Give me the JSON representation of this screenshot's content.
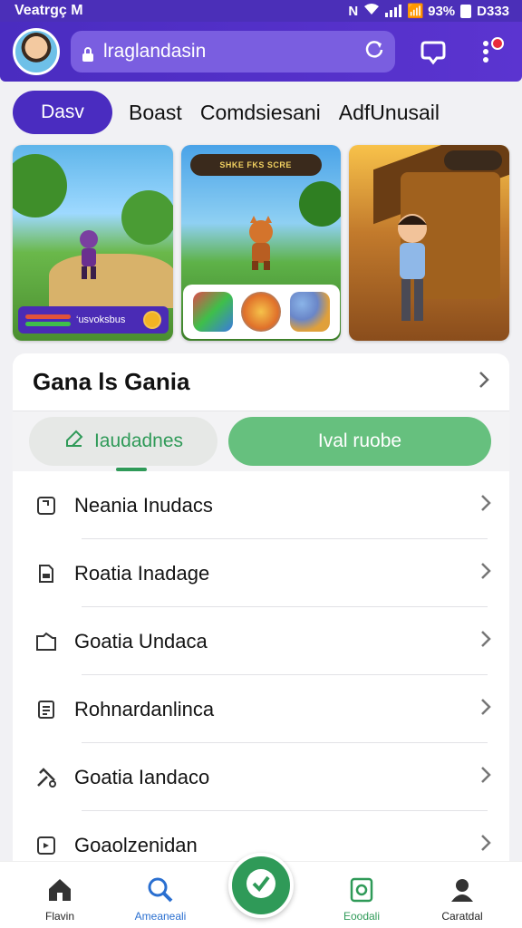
{
  "status_bar": {
    "carrier": "Veatrgç M",
    "battery_text": "📶 93%",
    "time": "D333",
    "network_label": "N"
  },
  "header": {
    "search_value": "lraglandasin",
    "icons": [
      "avatar",
      "lock-icon",
      "reload-icon",
      "chat-icon",
      "more-icon"
    ]
  },
  "tabs": [
    "Dasv",
    "Boast",
    "Comdsiesani",
    "AdfUnusail"
  ],
  "cards": [
    {
      "hud_text": "‘usvoksbus"
    },
    {
      "banner_text": "SHKE FKS SCRE"
    },
    {
      "icon": "game-scene"
    }
  ],
  "sheet": {
    "title": "Gana ls Gania",
    "segment_left": "Iaudadnes",
    "segment_right": "Ival ruobe",
    "items": [
      {
        "label": "Neania Inudacs",
        "icon": "page-icon"
      },
      {
        "label": "Roatia Inadage",
        "icon": "document-icon"
      },
      {
        "label": "Goatia Undaca",
        "icon": "folder-icon"
      },
      {
        "label": "Rohnardanlinca",
        "icon": "list-icon"
      },
      {
        "label": "Goatia Iandaco",
        "icon": "tools-icon"
      },
      {
        "label": "Goaolzenidan",
        "icon": "frame-icon"
      }
    ]
  },
  "bottom_nav": [
    {
      "label": "Flavin",
      "icon": "home-icon"
    },
    {
      "label": "Ameaneali",
      "icon": "search-icon"
    },
    {
      "label": "Eoodali",
      "icon": "feed-icon"
    },
    {
      "label": "Caratdal",
      "icon": "profile-icon"
    }
  ],
  "colors": {
    "primary": "#4a2cc0",
    "accent_green": "#2f9a58",
    "segment_green": "#66c07e",
    "notification_red": "#e82a3c"
  }
}
